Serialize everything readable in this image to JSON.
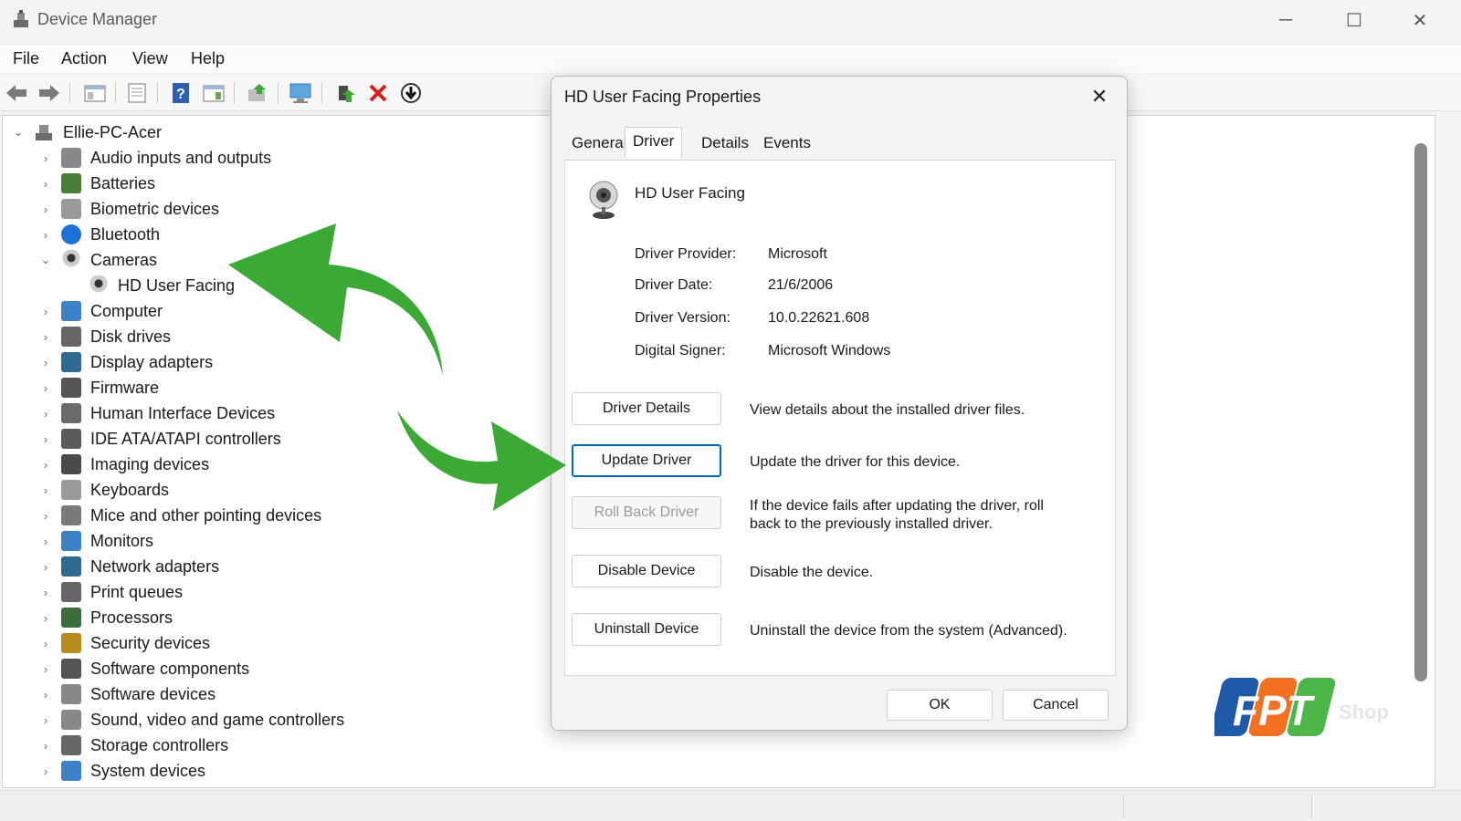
{
  "window": {
    "title": "Device Manager"
  },
  "menu": [
    "File",
    "Action",
    "View",
    "Help"
  ],
  "tree": {
    "root": "Ellie-PC-Acer",
    "items": [
      {
        "label": "Audio inputs and outputs",
        "icon": "speaker-icon",
        "expanded": false
      },
      {
        "label": "Batteries",
        "icon": "battery-icon",
        "expanded": false
      },
      {
        "label": "Biometric devices",
        "icon": "fingerprint-icon",
        "expanded": false
      },
      {
        "label": "Bluetooth",
        "icon": "bluetooth-icon",
        "expanded": false
      },
      {
        "label": "Cameras",
        "icon": "camera-icon",
        "expanded": true
      },
      {
        "label": "HD User Facing",
        "icon": "webcam-icon",
        "child": true
      },
      {
        "label": "Computer",
        "icon": "computer-icon",
        "expanded": false
      },
      {
        "label": "Disk drives",
        "icon": "disk-drive-icon",
        "expanded": false
      },
      {
        "label": "Display adapters",
        "icon": "display-adapter-icon",
        "expanded": false
      },
      {
        "label": "Firmware",
        "icon": "firmware-icon",
        "expanded": false
      },
      {
        "label": "Human Interface Devices",
        "icon": "hid-icon",
        "expanded": false
      },
      {
        "label": "IDE ATA/ATAPI controllers",
        "icon": "ide-controller-icon",
        "expanded": false
      },
      {
        "label": "Imaging devices",
        "icon": "imaging-icon",
        "expanded": false
      },
      {
        "label": "Keyboards",
        "icon": "keyboard-icon",
        "expanded": false
      },
      {
        "label": "Mice and other pointing devices",
        "icon": "mouse-icon",
        "expanded": false
      },
      {
        "label": "Monitors",
        "icon": "monitor-icon",
        "expanded": false
      },
      {
        "label": "Network adapters",
        "icon": "network-adapter-icon",
        "expanded": false
      },
      {
        "label": "Print queues",
        "icon": "printer-icon",
        "expanded": false
      },
      {
        "label": "Processors",
        "icon": "processor-icon",
        "expanded": false
      },
      {
        "label": "Security devices",
        "icon": "security-device-icon",
        "expanded": false
      },
      {
        "label": "Software components",
        "icon": "software-component-icon",
        "expanded": false
      },
      {
        "label": "Software devices",
        "icon": "software-device-icon",
        "expanded": false
      },
      {
        "label": "Sound, video and game controllers",
        "icon": "sound-controller-icon",
        "expanded": false
      },
      {
        "label": "Storage controllers",
        "icon": "storage-controller-icon",
        "expanded": false
      },
      {
        "label": "System devices",
        "icon": "system-device-icon",
        "expanded": false
      }
    ]
  },
  "dialog": {
    "title": "HD User Facing Properties",
    "tabs": [
      "General",
      "Driver",
      "Details",
      "Events"
    ],
    "active_tab": "Driver",
    "device_name": "HD User Facing",
    "fields": [
      {
        "key": "Driver Provider:",
        "value": "Microsoft"
      },
      {
        "key": "Driver Date:",
        "value": "21/6/2006"
      },
      {
        "key": "Driver Version:",
        "value": "10.0.22621.608"
      },
      {
        "key": "Digital Signer:",
        "value": "Microsoft Windows"
      }
    ],
    "actions": [
      {
        "label": "Driver Details",
        "desc": "View details about the installed driver files.",
        "state": "normal"
      },
      {
        "label": "Update Driver",
        "desc": "Update the driver for this device.",
        "state": "focused"
      },
      {
        "label": "Roll Back Driver",
        "desc": "If the device fails after updating the driver, roll back to the previously installed driver.",
        "state": "disabled"
      },
      {
        "label": "Disable Device",
        "desc": "Disable the device.",
        "state": "normal"
      },
      {
        "label": "Uninstall Device",
        "desc": "Uninstall the device from the system (Advanced).",
        "state": "normal"
      }
    ],
    "ok_label": "OK",
    "cancel_label": "Cancel"
  },
  "watermark": {
    "brand": "FPT",
    "suffix": "Shop"
  },
  "colors": {
    "accent": "#0067c0",
    "arrow_green": "#3aaa35",
    "fpt_blue": "#1f5aa8",
    "fpt_orange": "#f37021",
    "fpt_green": "#4cb748"
  }
}
